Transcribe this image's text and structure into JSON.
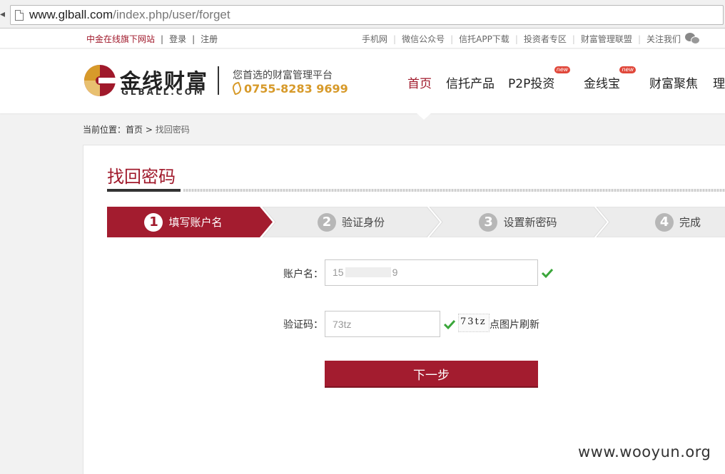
{
  "browser": {
    "url_host": "www.glball.com",
    "url_path": "/index.php/user/forget"
  },
  "topbar": {
    "brand": "中金在线旗下网站",
    "login": "登录",
    "register": "注册",
    "links": [
      "手机网",
      "微信公众号",
      "信托APP下载",
      "投资者专区",
      "财富管理联盟"
    ],
    "follow": "关注我们",
    "follow_icon": "wechat-icon"
  },
  "header": {
    "logo_text": "金线财富",
    "logo_sub": "GLBALL.COM",
    "slogan": "您首选的财富管理平台",
    "phone": "0755-8283 9699",
    "accent_color": "#a0192b",
    "phone_color": "#d79a2a"
  },
  "nav": {
    "items": [
      {
        "label": "首页",
        "active": true,
        "badge": ""
      },
      {
        "label": "信托产品",
        "active": false,
        "badge": ""
      },
      {
        "label": "P2P投资",
        "active": false,
        "badge": "new"
      },
      {
        "label": "金线宝",
        "active": false,
        "badge": "new"
      },
      {
        "label": "财富聚焦",
        "active": false,
        "badge": ""
      },
      {
        "label": "理",
        "active": false,
        "badge": ""
      }
    ]
  },
  "breadcrumb": {
    "prefix": "当前位置：",
    "home": "首页",
    "separator": ">",
    "current": "找回密码"
  },
  "main": {
    "title": "找回密码",
    "steps": [
      {
        "num": "1",
        "label": "填写账户名",
        "active": true
      },
      {
        "num": "2",
        "label": "验证身份",
        "active": false
      },
      {
        "num": "3",
        "label": "设置新密码",
        "active": false
      },
      {
        "num": "4",
        "label": "完成",
        "active": false
      }
    ],
    "account_label": "账户名：",
    "account_value": "15",
    "account_value_tail": "9",
    "captcha_label": "验证码：",
    "captcha_value": "73tz",
    "captcha_image_text": "73tz",
    "refresh_text": "点图片刷新",
    "next_button": "下一步"
  },
  "watermark": "www.wooyun.org"
}
